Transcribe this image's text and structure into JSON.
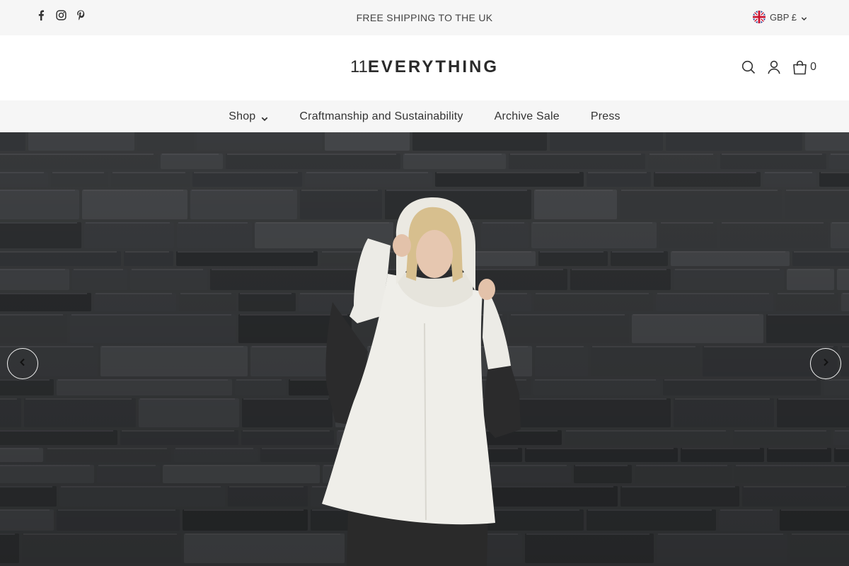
{
  "topbar": {
    "social": [
      {
        "name": "facebook-icon"
      },
      {
        "name": "instagram-icon"
      },
      {
        "name": "pinterest-icon"
      }
    ],
    "announcement": "FREE SHIPPING TO THE UK",
    "currency": "GBP £"
  },
  "header": {
    "logo_number": "11",
    "logo_word": "EVERYTHING",
    "cart_count": "0"
  },
  "nav": {
    "items": [
      {
        "label": "Shop",
        "has_dropdown": true
      },
      {
        "label": "Craftmanship and Sustainability"
      },
      {
        "label": "Archive Sale"
      },
      {
        "label": "Press"
      }
    ]
  },
  "hero": {
    "prev_icon": "chevron-left-icon",
    "next_icon": "chevron-right-icon"
  },
  "colors": {
    "topbar_bg": "#f6f6f6",
    "nav_bg": "#f6f6f6",
    "text": "#333333",
    "stone": "#3c3e40"
  }
}
